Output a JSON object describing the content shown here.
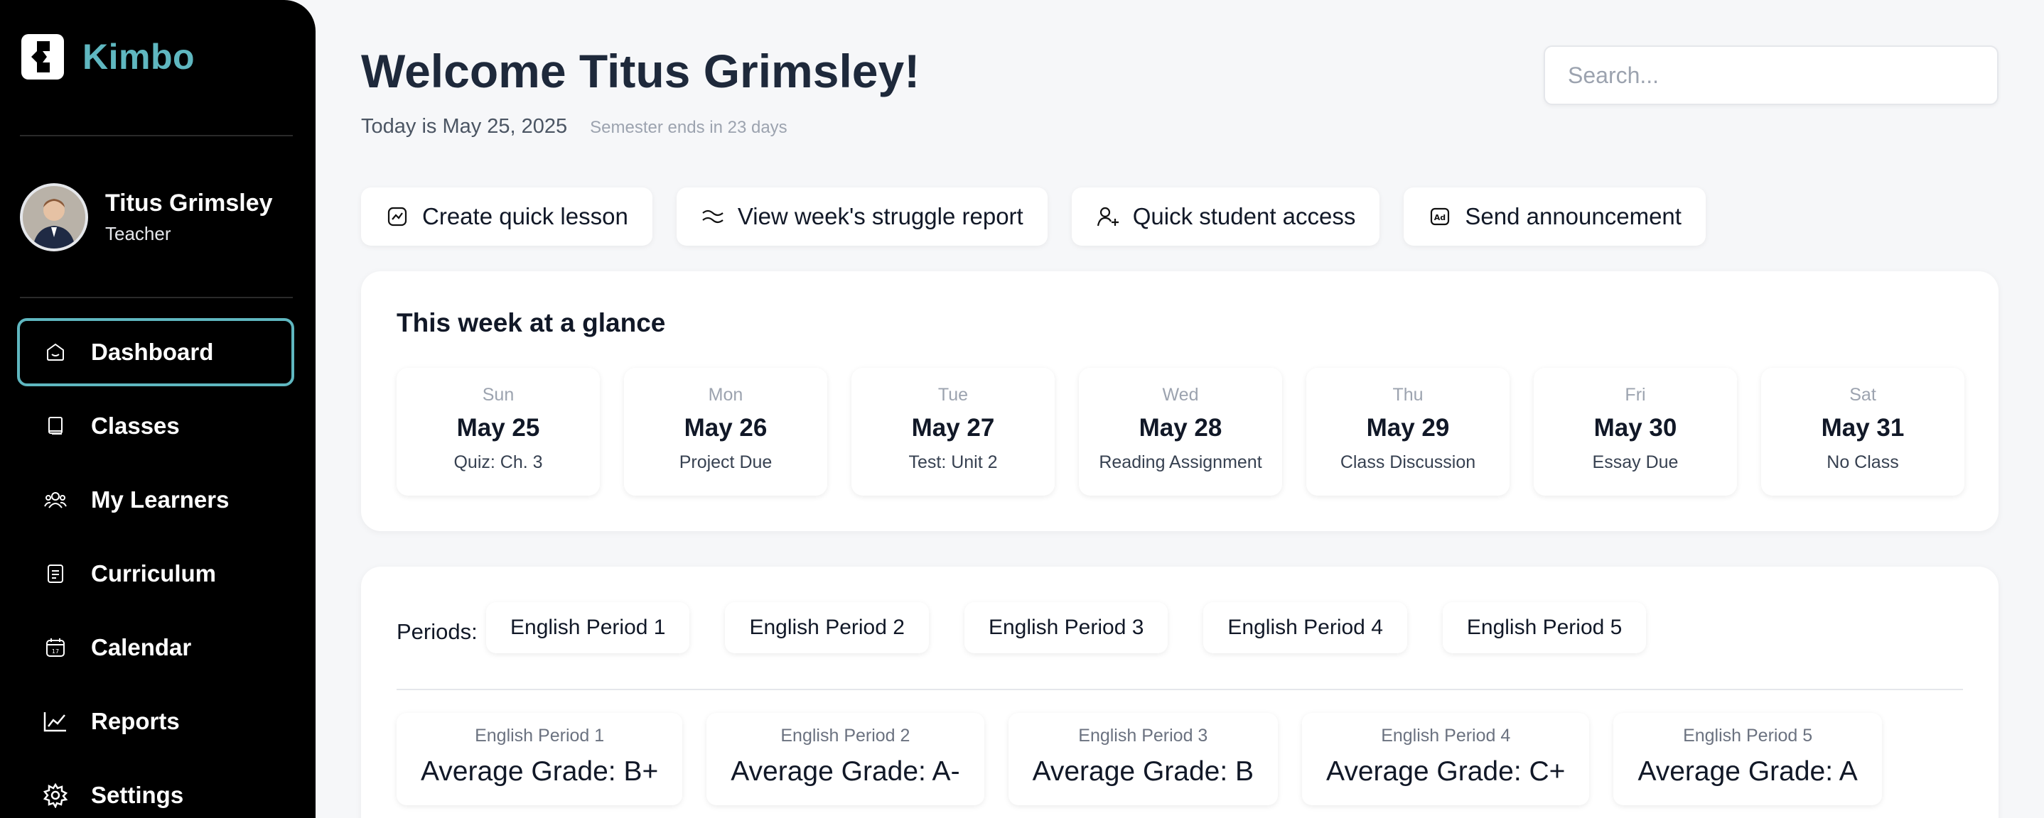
{
  "app": {
    "name": "Kimbo",
    "brand_color": "#5fb7c0"
  },
  "user": {
    "name": "Titus Grimsley",
    "role": "Teacher"
  },
  "nav": [
    {
      "label": "Dashboard",
      "icon": "home-icon",
      "active": true
    },
    {
      "label": "Classes",
      "icon": "book-icon"
    },
    {
      "label": "My Learners",
      "icon": "users-icon"
    },
    {
      "label": "Curriculum",
      "icon": "document-icon"
    },
    {
      "label": "Calendar",
      "icon": "calendar-icon"
    },
    {
      "label": "Reports",
      "icon": "chart-icon"
    },
    {
      "label": "Settings",
      "icon": "gear-icon"
    }
  ],
  "header": {
    "welcome": "Welcome Titus Grimsley!",
    "today": "Today is May 25, 2025",
    "semester": "Semester ends in 23 days",
    "search_placeholder": "Search..."
  },
  "actions": [
    {
      "label": "Create quick lesson",
      "icon": "lesson-icon"
    },
    {
      "label": "View week's struggle report",
      "icon": "trend-icon"
    },
    {
      "label": "Quick student access",
      "icon": "user-plus-icon"
    },
    {
      "label": "Send announcement",
      "icon": "announcement-icon"
    }
  ],
  "glance": {
    "title": "This week at a glance",
    "days": [
      {
        "name": "Sun",
        "date": "May 25",
        "event": "Quiz: Ch. 3"
      },
      {
        "name": "Mon",
        "date": "May 26",
        "event": "Project Due"
      },
      {
        "name": "Tue",
        "date": "May 27",
        "event": "Test: Unit 2"
      },
      {
        "name": "Wed",
        "date": "May 28",
        "event": "Reading Assignment"
      },
      {
        "name": "Thu",
        "date": "May 29",
        "event": "Class Discussion"
      },
      {
        "name": "Fri",
        "date": "May 30",
        "event": "Essay Due"
      },
      {
        "name": "Sat",
        "date": "May 31",
        "event": "No Class"
      }
    ]
  },
  "periods": {
    "label": "Periods:",
    "items": [
      "English Period 1",
      "English Period 2",
      "English Period 3",
      "English Period 4",
      "English Period 5"
    ],
    "grades": [
      {
        "period": "English Period 1",
        "grade": "Average Grade: B+"
      },
      {
        "period": "English Period 2",
        "grade": "Average Grade: A-"
      },
      {
        "period": "English Period 3",
        "grade": "Average Grade: B"
      },
      {
        "period": "English Period 4",
        "grade": "Average Grade: C+"
      },
      {
        "period": "English Period 5",
        "grade": "Average Grade: A"
      }
    ]
  }
}
